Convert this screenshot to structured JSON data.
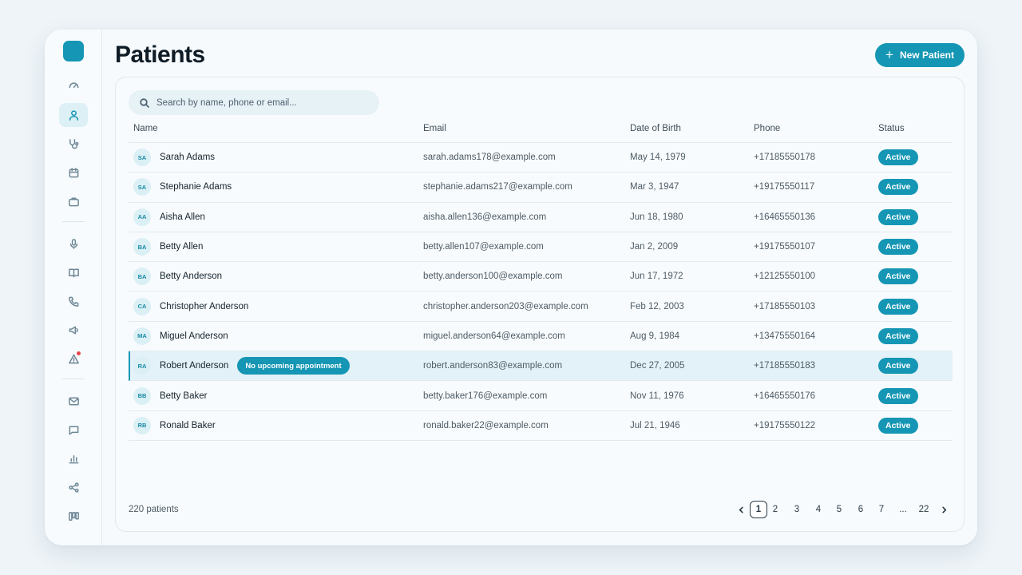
{
  "page": {
    "title": "Patients"
  },
  "actions": {
    "new_patient_label": "New Patient",
    "new_patient_icon": "plus-icon"
  },
  "search": {
    "placeholder": "Search by name, phone or email..."
  },
  "colors": {
    "accent": "#1496b4",
    "avatar_bg": "#daf0f5",
    "alert": "#e5484d"
  },
  "sidebar": {
    "items": [
      {
        "icon": "gauge-icon",
        "active": false
      },
      {
        "icon": "user-icon",
        "active": true
      },
      {
        "icon": "stethoscope-icon",
        "active": false
      },
      {
        "icon": "calendar-icon",
        "active": false
      },
      {
        "icon": "briefcase-icon",
        "active": false
      },
      {
        "icon": "microphone-icon",
        "active": false
      },
      {
        "icon": "book-icon",
        "active": false
      },
      {
        "icon": "phone-icon",
        "active": false
      },
      {
        "icon": "megaphone-icon",
        "active": false
      },
      {
        "icon": "warning-icon",
        "active": false,
        "notification": true
      },
      {
        "icon": "mail-icon",
        "active": false
      },
      {
        "icon": "chat-icon",
        "active": false
      },
      {
        "icon": "bar-chart-icon",
        "active": false
      },
      {
        "icon": "share-icon",
        "active": false
      },
      {
        "icon": "kanban-icon",
        "active": false
      }
    ]
  },
  "table": {
    "headers": {
      "name": "Name",
      "email": "Email",
      "dob": "Date of Birth",
      "phone": "Phone",
      "status": "Status"
    },
    "rows": [
      {
        "initials": "SA",
        "name": "Sarah Adams",
        "email": "sarah.adams178@example.com",
        "dob": "May 14, 1979",
        "phone": "+17185550178",
        "status": "Active"
      },
      {
        "initials": "SA",
        "name": "Stephanie Adams",
        "email": "stephanie.adams217@example.com",
        "dob": "Mar 3, 1947",
        "phone": "+19175550117",
        "status": "Active"
      },
      {
        "initials": "AA",
        "name": "Aisha Allen",
        "email": "aisha.allen136@example.com",
        "dob": "Jun 18, 1980",
        "phone": "+16465550136",
        "status": "Active"
      },
      {
        "initials": "BA",
        "name": "Betty Allen",
        "email": "betty.allen107@example.com",
        "dob": "Jan 2, 2009",
        "phone": "+19175550107",
        "status": "Active"
      },
      {
        "initials": "BA",
        "name": "Betty Anderson",
        "email": "betty.anderson100@example.com",
        "dob": "Jun 17, 1972",
        "phone": "+12125550100",
        "status": "Active"
      },
      {
        "initials": "CA",
        "name": "Christopher Anderson",
        "email": "christopher.anderson203@example.com",
        "dob": "Feb 12, 2003",
        "phone": "+17185550103",
        "status": "Active"
      },
      {
        "initials": "MA",
        "name": "Miguel Anderson",
        "email": "miguel.anderson64@example.com",
        "dob": "Aug 9, 1984",
        "phone": "+13475550164",
        "status": "Active"
      },
      {
        "initials": "RA",
        "name": "Robert Anderson",
        "tag": "No upcoming appointment",
        "highlighted": true,
        "email": "robert.anderson83@example.com",
        "dob": "Dec 27, 2005",
        "phone": "+17185550183",
        "status": "Active"
      },
      {
        "initials": "BB",
        "name": "Betty Baker",
        "email": "betty.baker176@example.com",
        "dob": "Nov 11, 1976",
        "phone": "+16465550176",
        "status": "Active"
      },
      {
        "initials": "RB",
        "name": "Ronald Baker",
        "email": "ronald.baker22@example.com",
        "dob": "Jul 21, 1946",
        "phone": "+19175550122",
        "status": "Active"
      }
    ]
  },
  "footer": {
    "count": "220 patients",
    "pages": [
      "1",
      "2",
      "3",
      "4",
      "5",
      "6",
      "7",
      "...",
      "22"
    ],
    "current_page": "1"
  }
}
